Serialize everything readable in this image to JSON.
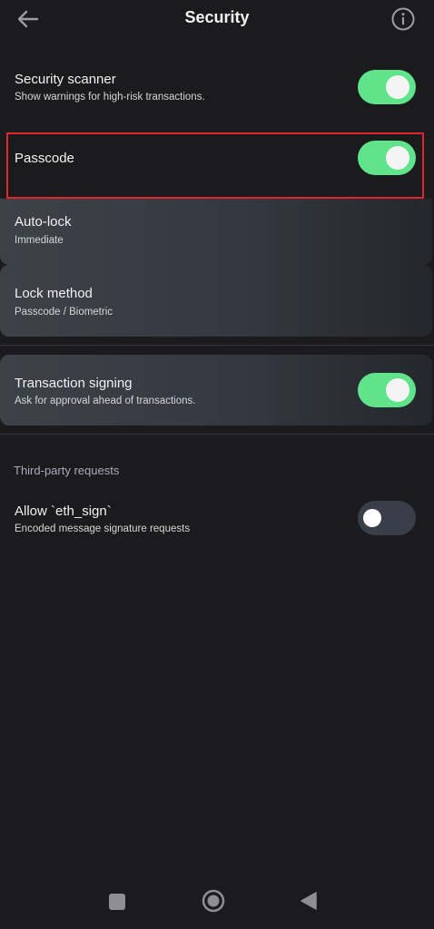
{
  "header": {
    "title": "Security",
    "back_icon": "arrow-left-icon",
    "info_icon": "info-circle-icon"
  },
  "settings": {
    "security_scanner": {
      "label": "Security scanner",
      "description": "Show warnings for high-risk transactions.",
      "enabled": true
    },
    "passcode": {
      "label": "Passcode",
      "enabled": true
    },
    "auto_lock": {
      "label": "Auto-lock",
      "value": "Immediate"
    },
    "lock_method": {
      "label": "Lock method",
      "value": "Passcode / Biometric"
    },
    "transaction_signing": {
      "label": "Transaction signing",
      "description": "Ask for approval ahead of transactions.",
      "enabled": true
    }
  },
  "third_party": {
    "header": "Third-party requests",
    "allow_eth_sign": {
      "label": "Allow `eth_sign`",
      "description": "Encoded message signature requests",
      "enabled": false
    }
  },
  "colors": {
    "background": "#1b1b1d",
    "toggle_on": "#5fe38b",
    "toggle_off": "#3a3e48",
    "highlight": "#e0252d",
    "section_header": "#a9aab8"
  },
  "nav": {
    "recents_icon": "square-icon",
    "home_icon": "circle-home-icon",
    "back_icon": "triangle-back-icon"
  }
}
